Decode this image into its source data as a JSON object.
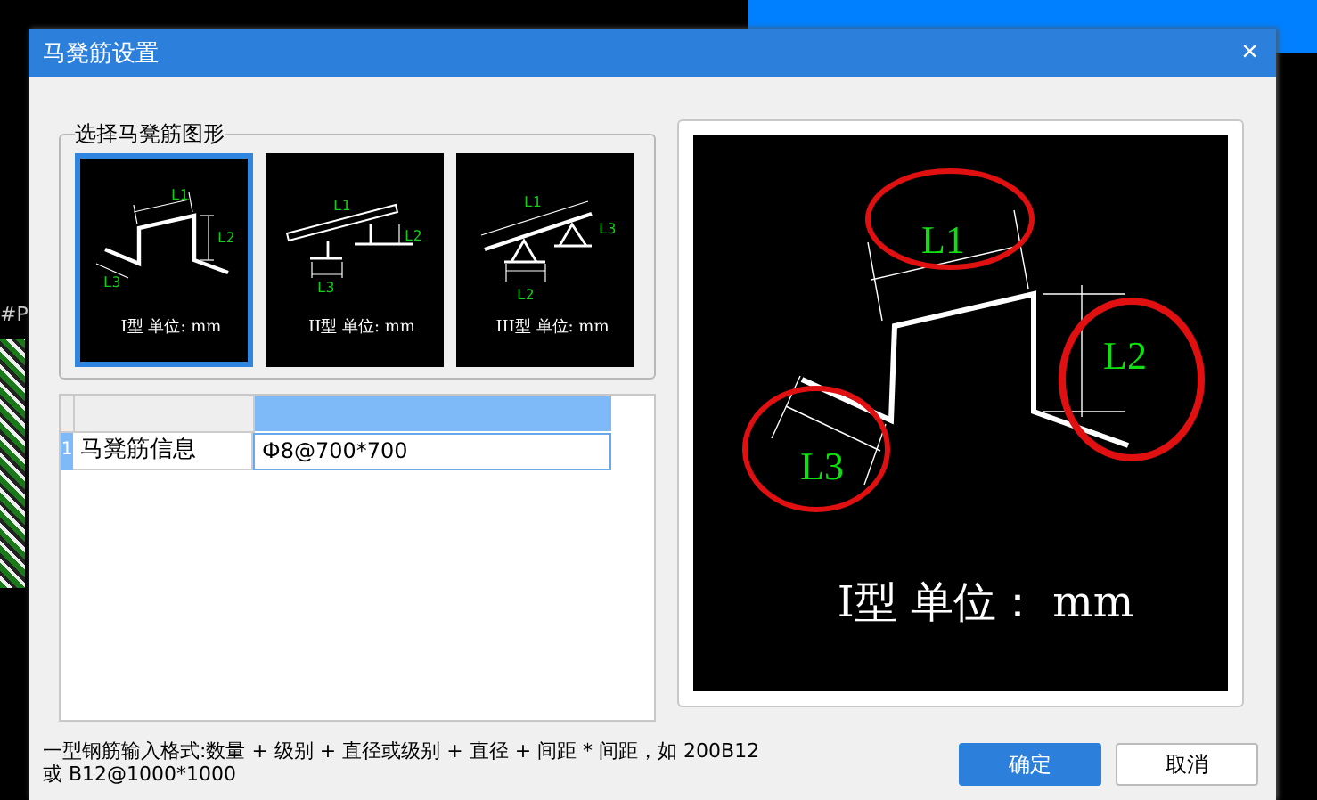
{
  "background": {
    "text": "#P"
  },
  "window": {
    "title": "马凳筋设置",
    "close": "×"
  },
  "shape_group": {
    "title": "选择马凳筋图形",
    "shapes": [
      {
        "kind": "type1",
        "selected": true,
        "labels": [
          "L1",
          "L2",
          "L3"
        ],
        "caption": "I型 单位: mm"
      },
      {
        "kind": "type2",
        "selected": false,
        "labels": [
          "L1",
          "L2",
          "L3"
        ],
        "caption": "II型 单位: mm"
      },
      {
        "kind": "type3",
        "selected": false,
        "labels": [
          "L1",
          "L3",
          "L2"
        ],
        "caption": "III型 单位: mm"
      }
    ]
  },
  "table": {
    "rows": [
      {
        "number": "1",
        "name": "马凳筋信息",
        "value": "Ф8@700*700",
        "selected": true
      }
    ]
  },
  "preview": {
    "labels": [
      "L1",
      "L2",
      "L3"
    ],
    "caption": "I型 单位： mm"
  },
  "hint": [
    "一型钢筋输入格式:数量 + 级别 + 直径或级别 + 直径 + 间距 * 间距，如 200B12",
    "或 B12@1000*1000"
  ],
  "buttons": [
    {
      "label": "确定",
      "primary": true
    },
    {
      "label": "取消",
      "primary": false
    }
  ]
}
